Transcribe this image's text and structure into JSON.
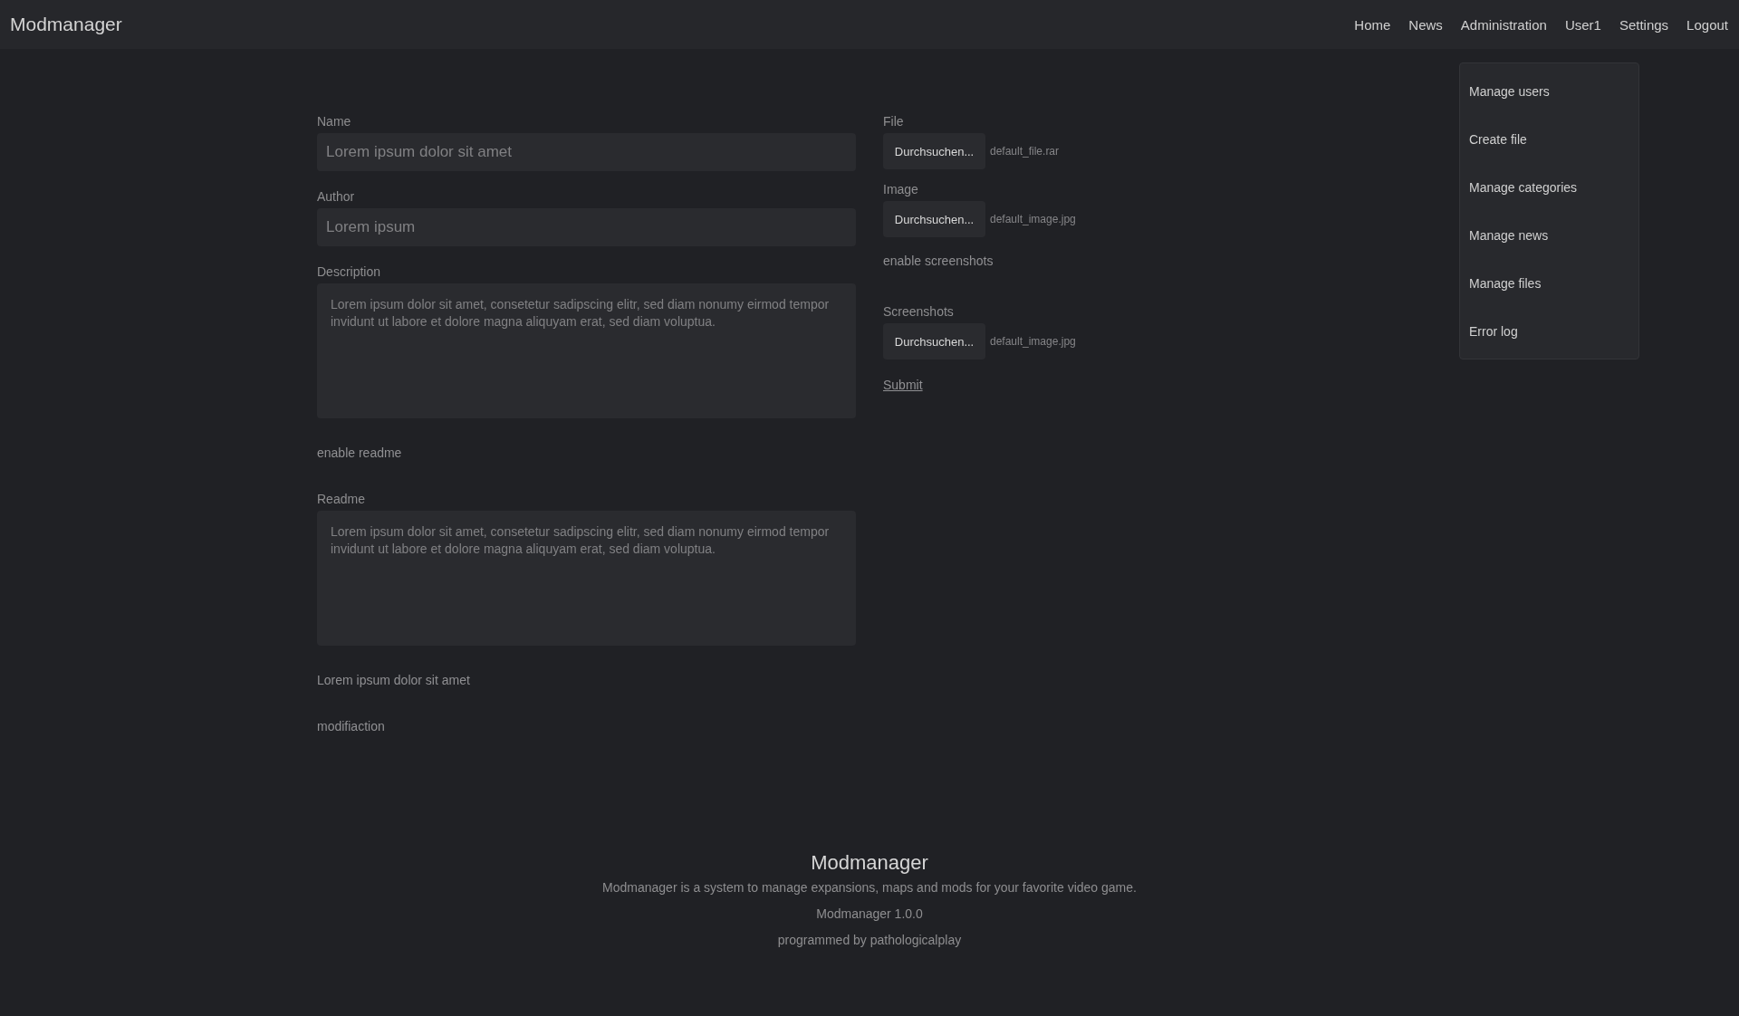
{
  "header": {
    "brand": "Modmanager",
    "nav": [
      {
        "label": "Home"
      },
      {
        "label": "News"
      },
      {
        "label": "Administration"
      },
      {
        "label": "User1"
      },
      {
        "label": "Settings"
      },
      {
        "label": "Logout"
      }
    ]
  },
  "admin_menu": {
    "items": [
      {
        "label": "Manage users"
      },
      {
        "label": "Create file"
      },
      {
        "label": "Manage categories"
      },
      {
        "label": "Manage news"
      },
      {
        "label": "Manage files"
      },
      {
        "label": "Error log"
      }
    ]
  },
  "form": {
    "left": [
      {
        "kind": "input",
        "label": "Name",
        "placeholder": "Lorem ipsum dolor sit amet"
      },
      {
        "kind": "input",
        "label": "Author",
        "placeholder": "Lorem ipsum"
      },
      {
        "kind": "textarea",
        "label": "Description",
        "placeholder": "Lorem ipsum dolor sit amet, consetetur sadipscing elitr, sed diam nonumy eirmod tempor invidunt ut labore et dolore magna aliquyam erat, sed diam voluptua."
      },
      {
        "kind": "text",
        "text": "enable readme"
      },
      {
        "kind": "textarea",
        "label": "Readme",
        "placeholder": "Lorem ipsum dolor sit amet, consetetur sadipscing elitr, sed diam nonumy eirmod tempor invidunt ut labore et dolore magna aliquyam erat, sed diam voluptua."
      },
      {
        "kind": "text",
        "text": "Lorem ipsum dolor sit amet"
      },
      {
        "kind": "text",
        "text": "modifiaction"
      }
    ],
    "right": [
      {
        "kind": "file",
        "label": "File",
        "button": "Durchsuchen...",
        "filename": "default_file.rar"
      },
      {
        "kind": "file",
        "label": "Image",
        "button": "Durchsuchen...",
        "filename": "default_image.jpg"
      },
      {
        "kind": "text",
        "text": "enable screenshots"
      },
      {
        "kind": "file",
        "label": "Screenshots",
        "button": "Durchsuchen...",
        "filename": "default_image.jpg"
      },
      {
        "kind": "link",
        "text": "Submit"
      }
    ]
  },
  "footer": {
    "title": "Modmanager",
    "description": "Modmanager is a system to manage expansions, maps and mods for your favorite video game.",
    "version": "Modmanager 1.0.0",
    "credit": "programmed by pathologicalplay"
  }
}
